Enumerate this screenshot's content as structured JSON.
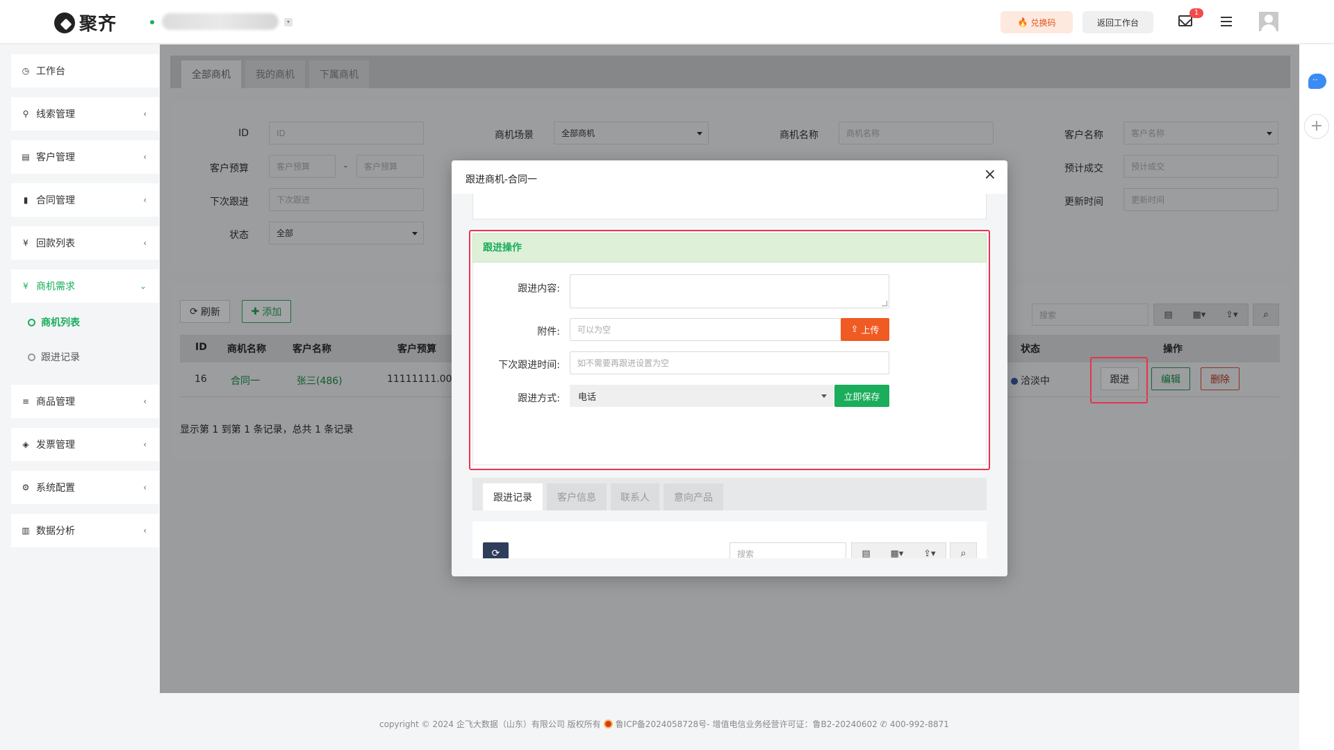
{
  "header": {
    "logo_text": "聚齐",
    "redeem_label": "兑换码",
    "return_label": "返回工作台",
    "mail_badge": "1"
  },
  "sidebar": {
    "items": [
      {
        "label": "工作台",
        "icon": "dashboard-icon",
        "glyph": "◷"
      },
      {
        "label": "线索管理",
        "icon": "link-icon",
        "glyph": "⚲"
      },
      {
        "label": "客户管理",
        "icon": "id-card-icon",
        "glyph": "▤"
      },
      {
        "label": "合同管理",
        "icon": "bookmark-icon",
        "glyph": "▮"
      },
      {
        "label": "回款列表",
        "icon": "yen-icon",
        "glyph": "¥"
      },
      {
        "label": "商机需求",
        "icon": "yen-icon",
        "glyph": "¥"
      },
      {
        "label": "商品管理",
        "icon": "list-icon",
        "glyph": "≡"
      },
      {
        "label": "发票管理",
        "icon": "ticket-icon",
        "glyph": "◈"
      },
      {
        "label": "系统配置",
        "icon": "gears-icon",
        "glyph": "⚙"
      },
      {
        "label": "数据分析",
        "icon": "bar-chart-icon",
        "glyph": "▥"
      }
    ],
    "sub_items": [
      {
        "label": "商机列表"
      },
      {
        "label": "跟进记录"
      }
    ],
    "chevron": "‹",
    "chevron_open": "⌄"
  },
  "tabs": [
    "全部商机",
    "我的商机",
    "下属商机"
  ],
  "filters": {
    "id": {
      "label": "ID",
      "placeholder": "ID"
    },
    "scene": {
      "label": "商机场景",
      "value": "全部商机"
    },
    "name": {
      "label": "商机名称",
      "placeholder": "商机名称"
    },
    "customer": {
      "label": "客户名称",
      "placeholder": "客户名称"
    },
    "budget": {
      "label": "客户预算",
      "placeholder": "客户预算",
      "dash": "-"
    },
    "deal": {
      "label": "预计成交",
      "placeholder": "预计成交"
    },
    "next_follow": {
      "label": "下次跟进",
      "placeholder": "下次跟进"
    },
    "updated": {
      "label": "更新时间",
      "placeholder": "更新时间"
    },
    "status": {
      "label": "状态",
      "value": "全部"
    }
  },
  "toolbar": {
    "refresh_label": "刷新",
    "add_label": "添加",
    "search_placeholder": "搜索"
  },
  "table": {
    "headers": [
      "ID",
      "商机名称",
      "客户名称",
      "客户预算",
      "状态",
      "操作"
    ],
    "rows": [
      {
        "id": "16",
        "name": "合同一",
        "customer": "张三(486)",
        "budget": "11111111.00",
        "status": "洽淡中"
      }
    ],
    "actions": {
      "follow": "跟进",
      "edit": "编辑",
      "delete": "删除"
    },
    "pager_text": "显示第 1 到第 1 条记录，总共 1 条记录"
  },
  "modal": {
    "title": "跟进商机-合同一",
    "close": "×",
    "section_title": "跟进操作",
    "content_label": "跟进内容:",
    "attachment_label": "附件:",
    "attachment_placeholder": "可以为空",
    "upload_label": "上传",
    "next_time_label": "下次跟进时间:",
    "next_time_placeholder": "如不需要再跟进设置为空",
    "method_label": "跟进方式:",
    "method_value": "电话",
    "save_label": "立即保存",
    "subtabs": [
      "跟进记录",
      "客户信息",
      "联系人",
      "意向产品"
    ],
    "search_placeholder": "搜索"
  },
  "footer": {
    "copyright": "copyright © 2024 企飞大数据（山东）有限公司 版权所有",
    "icp": "鲁ICP备2024058728号-",
    "license": "增值电信业务经营许可证：鲁B2-20240602",
    "phone": "400-992-8871"
  },
  "colors": {
    "brand_green": "#1aad5b",
    "upload_orange": "#f05a23",
    "highlight_red": "#e6334f"
  }
}
